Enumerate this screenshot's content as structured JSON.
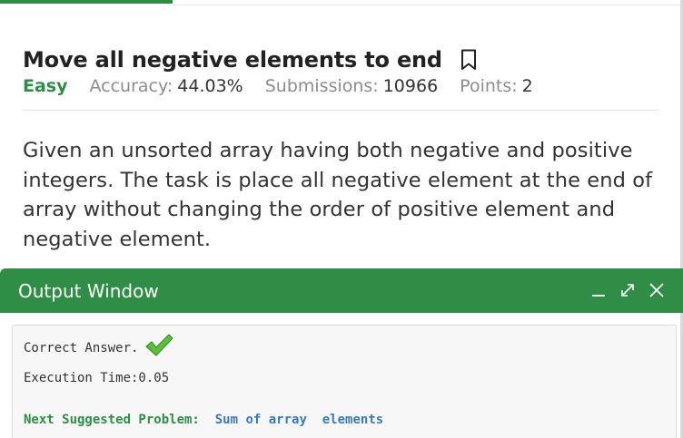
{
  "problem": {
    "title": "Move all negative elements to end",
    "difficulty": "Easy",
    "accuracy_label": "Accuracy:",
    "accuracy_value": "44.03%",
    "submissions_label": "Submissions:",
    "submissions_value": "10966",
    "points_label": "Points:",
    "points_value": "2",
    "statement_lines": [
      "Given an unsorted array having both negative and positive",
      "integers. The task is place all negative element at the end of",
      "array without changing the order of positive element and",
      "negative element."
    ]
  },
  "output_window": {
    "title": "Output Window",
    "result_text": "Correct Answer.",
    "execution_time": "Execution Time:0.05",
    "next_label": "Next Suggested Problem:",
    "next_problem": "Sum of array  elements"
  },
  "icons": {
    "bookmark": "bookmark-icon",
    "minimize": "minimize-icon",
    "expand": "expand-icon",
    "close": "close-icon",
    "check": "check-icon"
  },
  "colors": {
    "accent": "#2f8d46",
    "link": "#3a7ab8",
    "check": "#4caf3a"
  }
}
